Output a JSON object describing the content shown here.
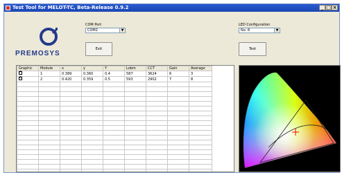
{
  "window": {
    "title": "Test Tool for MELOT-TC, Beta-Release 0.9.2",
    "min": "_",
    "max": "□",
    "close": "×"
  },
  "com_port": {
    "label": "COM Port",
    "value": "COM2"
  },
  "exit_label": "Exit",
  "led_config": {
    "label": "LED Configuration",
    "value": "No. 8"
  },
  "test_label": "Test",
  "brand": "PREMOSYS",
  "table": {
    "headers": [
      "Graphic",
      "Module",
      "x",
      "y",
      "Y",
      "Lobm",
      "CCT",
      "Gain",
      "Average"
    ],
    "rows": [
      {
        "checked": true,
        "cells": [
          "1",
          "0.389",
          "0.360",
          "0.4",
          "587",
          "3624",
          "6",
          "3"
        ]
      },
      {
        "checked": true,
        "cells": [
          "2",
          "0.420",
          "0.359",
          "0.5",
          "593",
          "2902",
          "7",
          "8"
        ]
      }
    ]
  },
  "colors": {
    "title_bar": "#1f4fc4",
    "logo_blue": "#233a8c",
    "chart_bg": "#000000",
    "marker": "#ff0000"
  }
}
